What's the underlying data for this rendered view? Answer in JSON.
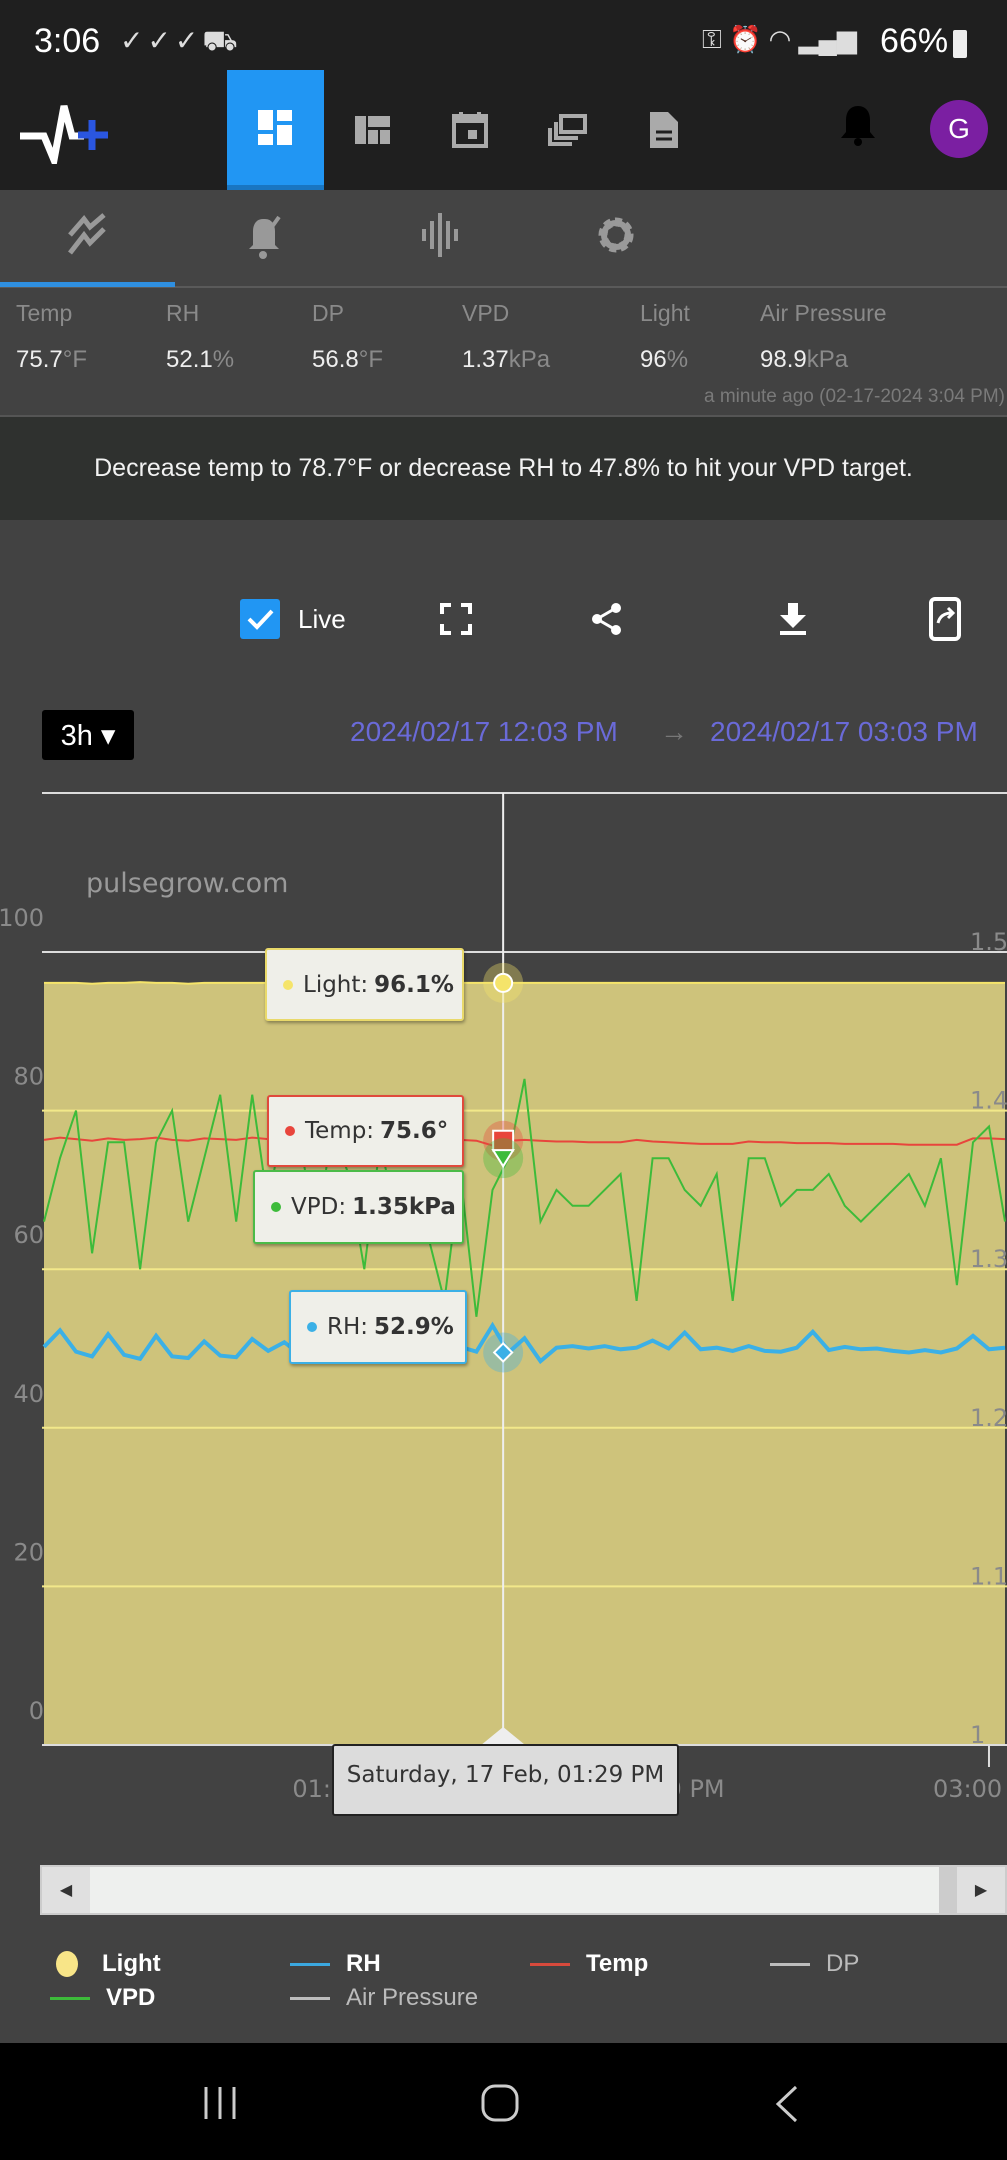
{
  "status_bar": {
    "time": "3:06",
    "battery": "66%"
  },
  "nav": {
    "avatar_letter": "G",
    "tabs": [
      "dashboard",
      "layout",
      "calendar",
      "devices",
      "reports"
    ]
  },
  "metrics": [
    {
      "label": "Temp",
      "value": "75.7",
      "unit": "°F"
    },
    {
      "label": "RH",
      "value": "52.1",
      "unit": "%"
    },
    {
      "label": "DP",
      "value": "56.8",
      "unit": "°F"
    },
    {
      "label": "VPD",
      "value": "1.37",
      "unit": "kPa"
    },
    {
      "label": "Light",
      "value": "96",
      "unit": "%"
    },
    {
      "label": "Air Pressure",
      "value": "98.9",
      "unit": "kPa"
    }
  ],
  "timestamp": "a minute ago (02-17-2024 3:04 PM)",
  "advice": "Decrease temp to 78.7°F or decrease RH to 47.8% to hit your VPD target.",
  "toolbar": {
    "live_label": "Live",
    "live_checked": true
  },
  "range": {
    "button": "3h ▾",
    "start": "2024/02/17 12:03 PM",
    "arrow": "→",
    "end": "2024/02/17 03:03 PM"
  },
  "chart_data": {
    "type": "line",
    "watermark": "pulsegrow.com",
    "x_start_minutes": 0,
    "x_end_minutes": 180,
    "x_step_minutes": 3,
    "x_ticks": [
      "01:00 PM",
      "02:00 PM",
      "03:00 PM"
    ],
    "y_left": {
      "range": [
        0,
        100
      ],
      "ticks": [
        "0",
        "20",
        "40",
        "60",
        "80",
        "100"
      ]
    },
    "y_right": {
      "range": [
        1.0,
        1.5
      ],
      "ticks": [
        "1",
        "1.1",
        "1.2",
        "1.3",
        "1.4",
        "1.5"
      ]
    },
    "series": [
      {
        "name": "Light",
        "axis": "left",
        "color": "#f5e46a",
        "fill": true,
        "values": [
          96.1,
          96.1,
          96.1,
          96,
          96.1,
          96.1,
          96.2,
          96.1,
          96.1,
          96,
          96.1,
          96.1,
          96.1,
          96.1,
          96.1,
          96.1,
          96.1,
          96.1,
          96.1,
          96.1,
          96.1,
          96,
          96.1,
          96.1,
          96.1,
          96.1,
          96.1,
          96.1,
          96.1,
          96.1,
          96.1,
          96.1,
          96.1,
          96.1,
          96.1,
          96.1,
          96.1,
          96.1,
          96.1,
          96.1,
          96.1,
          96.1,
          96.1,
          96.1,
          96.1,
          96.1,
          96.1,
          96.1,
          96.1,
          96.1,
          96.1,
          96.1,
          96.1,
          96.1,
          96.1,
          96.1,
          96.1,
          96.1,
          96.1,
          96.1,
          96.1
        ]
      },
      {
        "name": "Temp",
        "axis": "left",
        "color": "#e8453c",
        "values": [
          76.3,
          76.6,
          76.4,
          76.2,
          76.5,
          76.3,
          76.4,
          76.6,
          76.3,
          76.2,
          76.5,
          76.4,
          76.3,
          76.6,
          76.4,
          76.2,
          76.5,
          76.4,
          76.3,
          76.5,
          76.4,
          76.2,
          76.3,
          76.4,
          76.3,
          76.2,
          76.3,
          76.2,
          75.6,
          76.2,
          76.3,
          76.2,
          76.1,
          76.1,
          76.0,
          76.0,
          76.0,
          76.3,
          76.1,
          76.0,
          75.9,
          75.8,
          75.8,
          75.8,
          76.1,
          76.0,
          76.0,
          75.9,
          75.9,
          75.9,
          75.8,
          75.8,
          75.8,
          75.8,
          75.7,
          75.7,
          75.7,
          75.7,
          76.5,
          76.5,
          76.4
        ]
      },
      {
        "name": "RH",
        "axis": "left",
        "color": "#3bb0e6",
        "values": [
          50.2,
          52.3,
          49.6,
          49.0,
          51.8,
          49.2,
          48.7,
          51.6,
          49.0,
          48.8,
          50.9,
          49.1,
          48.9,
          51.2,
          49.7,
          50.8,
          49.2,
          52.0,
          50.8,
          51.6,
          50.1,
          49.0,
          52.2,
          49.8,
          51.8,
          52.9,
          50.2,
          49.6,
          52.9,
          49.5,
          51.3,
          48.4,
          50.1,
          50.3,
          50.0,
          50.3,
          49.9,
          50.1,
          51.0,
          50.0,
          52.0,
          49.9,
          50.1,
          49.7,
          50.3,
          49.7,
          49.6,
          50.1,
          52.1,
          49.8,
          50.2,
          49.9,
          50.0,
          49.7,
          49.5,
          49.8,
          49.5,
          50.0,
          51.6,
          49.9,
          50.1
        ]
      },
      {
        "name": "VPD",
        "axis": "right",
        "color": "#3dbb3a",
        "values": [
          1.33,
          1.37,
          1.4,
          1.31,
          1.38,
          1.38,
          1.3,
          1.38,
          1.4,
          1.33,
          1.37,
          1.41,
          1.33,
          1.41,
          1.34,
          1.4,
          1.38,
          1.32,
          1.39,
          1.36,
          1.3,
          1.38,
          1.33,
          1.36,
          1.32,
          1.28,
          1.36,
          1.27,
          1.35,
          1.37,
          1.42,
          1.33,
          1.35,
          1.34,
          1.34,
          1.35,
          1.36,
          1.28,
          1.37,
          1.37,
          1.35,
          1.34,
          1.36,
          1.28,
          1.37,
          1.37,
          1.34,
          1.35,
          1.35,
          1.36,
          1.34,
          1.33,
          1.34,
          1.35,
          1.36,
          1.34,
          1.37,
          1.29,
          1.38,
          1.39,
          1.33
        ]
      },
      {
        "name": "DP",
        "axis": "left",
        "color": "#bdbdbd",
        "hidden": true,
        "values": []
      },
      {
        "name": "Air Pressure",
        "axis": "right",
        "color": "#bdbdbd",
        "hidden": true,
        "values": []
      }
    ],
    "crosshair": {
      "date_label": "Saturday, 17 Feb, 01:29 PM",
      "minute": 86
    },
    "tooltips": [
      {
        "name": "Light",
        "label": "Light:",
        "value": "96.1%",
        "color": "#f5e46a",
        "border": "#e9d96a"
      },
      {
        "name": "Temp",
        "label": "Temp:",
        "value": "75.6°",
        "color": "#e8453c",
        "border": "#e04a3c"
      },
      {
        "name": "VPD",
        "label": "VPD:",
        "value": "1.35kPa",
        "color": "#3dbb3a",
        "border": "#4bbb48"
      },
      {
        "name": "RH",
        "label": "RH:",
        "value": "52.9%",
        "color": "#3bb0e6",
        "border": "#3bb0e6"
      }
    ]
  },
  "legend": [
    {
      "label": "Light",
      "color": "#f8e588",
      "dot": true,
      "dim": false
    },
    {
      "label": "RH",
      "color": "#3ba8e0",
      "dim": false
    },
    {
      "label": "Temp",
      "color": "#d84a3c",
      "dim": false
    },
    {
      "label": "DP",
      "color": "#bdbdbd",
      "dim": true
    },
    {
      "label": "VPD",
      "color": "#3dbb3a",
      "dim": false
    },
    {
      "label": "Air Pressure",
      "color": "#bdbdbd",
      "dim": true
    }
  ]
}
